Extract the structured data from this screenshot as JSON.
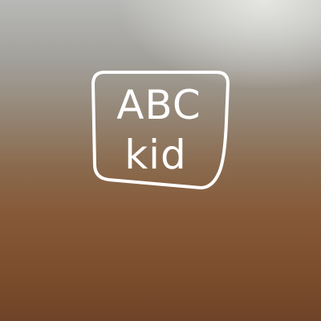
{
  "splash": {
    "logo": {
      "line1": "ABC",
      "line2": "kid"
    }
  },
  "colors": {
    "logo": "#ffffff",
    "background_top": "#b8b8b6",
    "background_bottom": "#7d4e2e"
  }
}
